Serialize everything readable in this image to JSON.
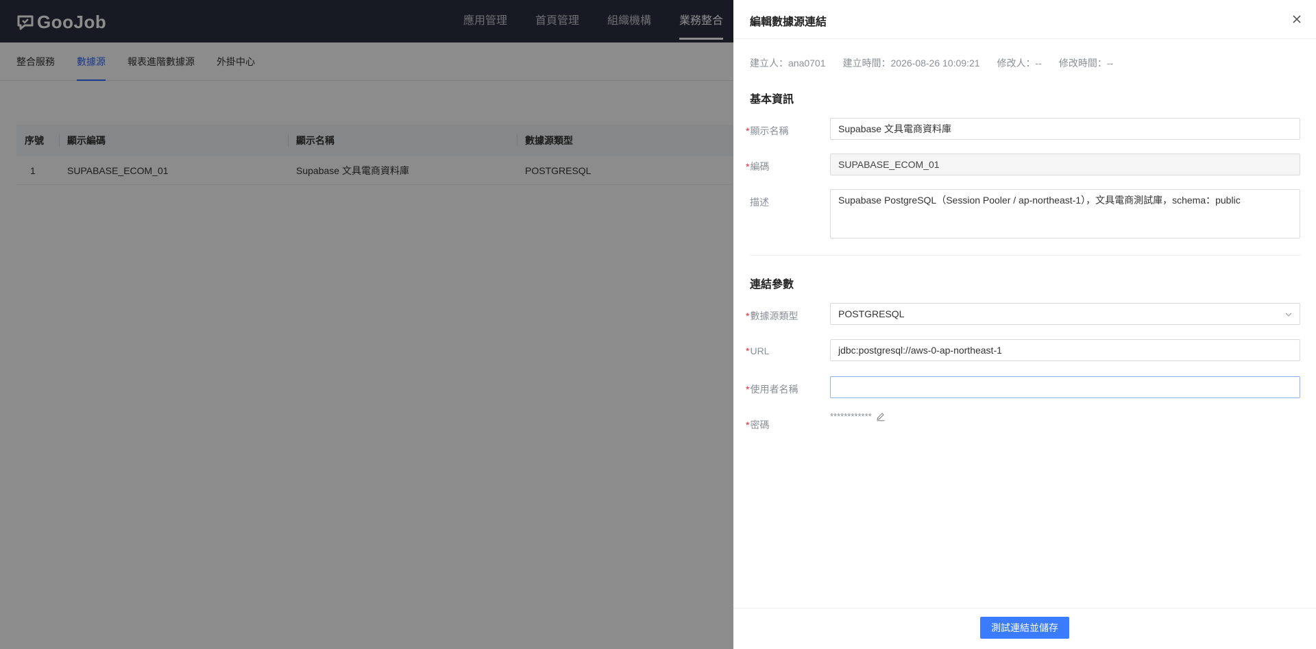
{
  "app": {
    "logo_text": "GooJob",
    "top_nav": [
      "應用管理",
      "首頁管理",
      "組織機構",
      "業務整合"
    ],
    "active_top_nav": "業務整合"
  },
  "subnav": {
    "items": [
      "整合服務",
      "數據源",
      "報表進階數據源",
      "外掛中心"
    ],
    "active": "數據源"
  },
  "table": {
    "headers": [
      "序號",
      "顯示編碼",
      "顯示名稱",
      "數據源類型"
    ],
    "rows": [
      [
        "1",
        "SUPABASE_ECOM_01",
        "Supabase 文具電商資料庫",
        "POSTGRESQL"
      ]
    ]
  },
  "drawer": {
    "title": "編輯數據源連結",
    "meta": {
      "creator": "建立人：ana0701",
      "created_at": "建立時間：2026-08-26 10:09:21",
      "modifier": "修改人：--",
      "modified_at": "修改時間：--"
    },
    "basic_section": "基本資訊",
    "fields": {
      "display_name": {
        "label": "顯示名稱",
        "value": "Supabase 文具電商資料庫"
      },
      "code": {
        "label": "編碼",
        "value": "SUPABASE_ECOM_01"
      },
      "description": {
        "label": "描述",
        "value": "Supabase PostgreSQL（Session Pooler / ap-northeast-1），文具電商測試庫，schema：public"
      }
    },
    "connection_section": "連結參數",
    "conn_fields": {
      "type": {
        "label": "數據源類型",
        "value": "POSTGRESQL"
      },
      "url": {
        "label": "URL",
        "value": "jdbc:postgresql://aws-0-ap-northeast-1"
      },
      "username": {
        "label": "使用者名稱",
        "value": ""
      },
      "password": {
        "label": "密碼",
        "masked": "************"
      }
    },
    "submit_label": "測試連結並儲存"
  }
}
